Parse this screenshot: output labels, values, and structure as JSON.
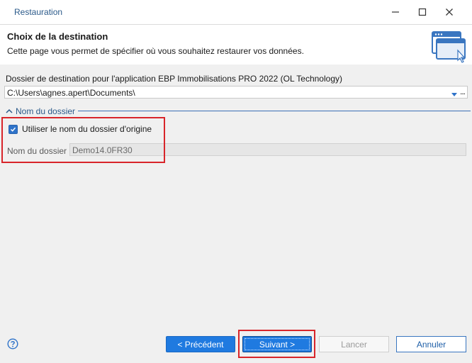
{
  "window": {
    "title": "Restauration"
  },
  "header": {
    "title": "Choix de la destination",
    "subtitle": "Cette page vous permet de spécifier où vous souhaitez restaurer vos données."
  },
  "destination": {
    "label": "Dossier de destination pour l'application EBP Immobilisations PRO 2022 (OL Technology)",
    "path": "C:\\Users\\agnes.apert\\Documents\\",
    "more": "..."
  },
  "folder_group": {
    "title": "Nom du dossier",
    "use_origin_label": "Utiliser le nom du dossier d'origine",
    "use_origin_checked": true,
    "folder_label": "Nom du dossier",
    "folder_value": "Demo14.0FR30"
  },
  "buttons": {
    "previous": "< Précédent",
    "next": "Suivant >",
    "cancel": "Lancer",
    "quit": "Annuler"
  },
  "colors": {
    "accent": "#1f7ae0",
    "highlight": "#d8252a"
  },
  "icons": [
    "minimize-icon",
    "maximize-icon",
    "close-icon",
    "window-icon",
    "help-icon",
    "chevron-up-icon",
    "checkmark-icon",
    "dropdown-arrow-icon"
  ]
}
